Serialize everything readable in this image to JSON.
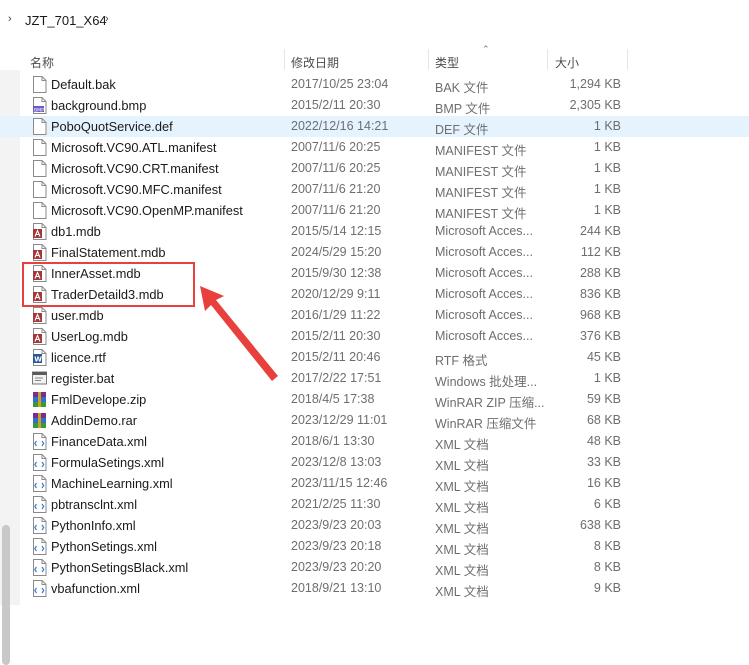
{
  "breadcrumb": {
    "folder": "JZT_701_X64"
  },
  "columns": {
    "name": "名称",
    "date": "修改日期",
    "type": "类型",
    "size": "大小"
  },
  "files": [
    {
      "name": "Default.bak",
      "date": "2017/10/25 23:04",
      "type": "BAK 文件",
      "size": "1,294 KB",
      "icon": "generic-file-icon"
    },
    {
      "name": "background.bmp",
      "date": "2015/2/11 20:30",
      "type": "BMP 文件",
      "size": "2,305 KB",
      "icon": "bmp-file-icon"
    },
    {
      "name": "PoboQuotService.def",
      "date": "2022/12/16 14:21",
      "type": "DEF 文件",
      "size": "1 KB",
      "icon": "generic-file-icon",
      "selected": true
    },
    {
      "name": "Microsoft.VC90.ATL.manifest",
      "date": "2007/11/6 20:25",
      "type": "MANIFEST 文件",
      "size": "1 KB",
      "icon": "generic-file-icon"
    },
    {
      "name": "Microsoft.VC90.CRT.manifest",
      "date": "2007/11/6 20:25",
      "type": "MANIFEST 文件",
      "size": "1 KB",
      "icon": "generic-file-icon"
    },
    {
      "name": "Microsoft.VC90.MFC.manifest",
      "date": "2007/11/6 21:20",
      "type": "MANIFEST 文件",
      "size": "1 KB",
      "icon": "generic-file-icon"
    },
    {
      "name": "Microsoft.VC90.OpenMP.manifest",
      "date": "2007/11/6 21:20",
      "type": "MANIFEST 文件",
      "size": "1 KB",
      "icon": "generic-file-icon"
    },
    {
      "name": "db1.mdb",
      "date": "2015/5/14 12:15",
      "type": "Microsoft Acces...",
      "size": "244 KB",
      "icon": "access-db-icon"
    },
    {
      "name": "FinalStatement.mdb",
      "date": "2024/5/29 15:20",
      "type": "Microsoft Acces...",
      "size": "112 KB",
      "icon": "access-db-icon"
    },
    {
      "name": "InnerAsset.mdb",
      "date": "2015/9/30 12:38",
      "type": "Microsoft Acces...",
      "size": "288 KB",
      "icon": "access-db-icon"
    },
    {
      "name": "TraderDetaild3.mdb",
      "date": "2020/12/29 9:11",
      "type": "Microsoft Acces...",
      "size": "836 KB",
      "icon": "access-db-icon"
    },
    {
      "name": "user.mdb",
      "date": "2016/1/29 11:22",
      "type": "Microsoft Acces...",
      "size": "968 KB",
      "icon": "access-db-icon"
    },
    {
      "name": "UserLog.mdb",
      "date": "2015/2/11 20:30",
      "type": "Microsoft Acces...",
      "size": "376 KB",
      "icon": "access-db-icon"
    },
    {
      "name": "licence.rtf",
      "date": "2015/2/11 20:46",
      "type": "RTF 格式",
      "size": "45 KB",
      "icon": "word-doc-icon"
    },
    {
      "name": "register.bat",
      "date": "2017/2/22 17:51",
      "type": "Windows 批处理...",
      "size": "1 KB",
      "icon": "batch-file-icon"
    },
    {
      "name": "FmlDevelope.zip",
      "date": "2018/4/5 17:38",
      "type": "WinRAR ZIP 压缩...",
      "size": "59 KB",
      "icon": "winrar-archive-icon"
    },
    {
      "name": "AddinDemo.rar",
      "date": "2023/12/29 11:01",
      "type": "WinRAR 压缩文件",
      "size": "68 KB",
      "icon": "winrar-archive-icon"
    },
    {
      "name": "FinanceData.xml",
      "date": "2018/6/1 13:30",
      "type": "XML 文档",
      "size": "48 KB",
      "icon": "xml-file-icon"
    },
    {
      "name": "FormulaSetings.xml",
      "date": "2023/12/8 13:03",
      "type": "XML 文档",
      "size": "33 KB",
      "icon": "xml-file-icon"
    },
    {
      "name": "MachineLearning.xml",
      "date": "2023/11/15 12:46",
      "type": "XML 文档",
      "size": "16 KB",
      "icon": "xml-file-icon"
    },
    {
      "name": "pbtransclnt.xml",
      "date": "2021/2/25 11:30",
      "type": "XML 文档",
      "size": "6 KB",
      "icon": "xml-file-icon"
    },
    {
      "name": "PythonInfo.xml",
      "date": "2023/9/23 20:03",
      "type": "XML 文档",
      "size": "638 KB",
      "icon": "xml-file-icon"
    },
    {
      "name": "PythonSetings.xml",
      "date": "2023/9/23 20:18",
      "type": "XML 文档",
      "size": "8 KB",
      "icon": "xml-file-icon"
    },
    {
      "name": "PythonSetingsBlack.xml",
      "date": "2023/9/23 20:20",
      "type": "XML 文档",
      "size": "8 KB",
      "icon": "xml-file-icon"
    },
    {
      "name": "vbafunction.xml",
      "date": "2018/9/21 13:10",
      "type": "XML 文档",
      "size": "9 KB",
      "icon": "xml-file-icon"
    }
  ],
  "colors": {
    "selected_row": "#e5f3ff",
    "annotation": "#e8413d",
    "access_red": "#a4373a"
  }
}
